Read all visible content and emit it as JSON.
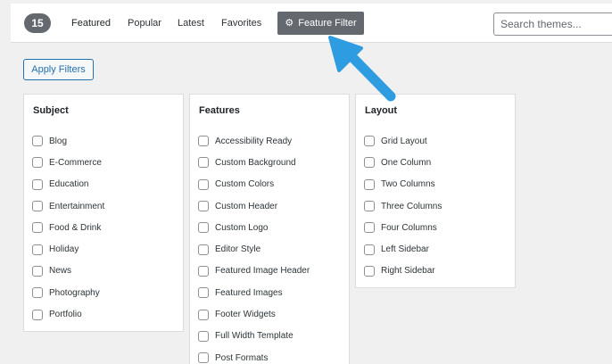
{
  "toolbar": {
    "count": "15",
    "tabs": [
      {
        "label": "Featured"
      },
      {
        "label": "Popular"
      },
      {
        "label": "Latest"
      },
      {
        "label": "Favorites"
      }
    ],
    "feature_filter_label": "Feature Filter",
    "search_placeholder": "Search themes..."
  },
  "apply_filters_label": "Apply Filters",
  "columns": [
    {
      "heading": "Subject",
      "options": [
        "Blog",
        "E-Commerce",
        "Education",
        "Entertainment",
        "Food & Drink",
        "Holiday",
        "News",
        "Photography",
        "Portfolio"
      ]
    },
    {
      "heading": "Features",
      "options": [
        "Accessibility Ready",
        "Custom Background",
        "Custom Colors",
        "Custom Header",
        "Custom Logo",
        "Editor Style",
        "Featured Image Header",
        "Featured Images",
        "Footer Widgets",
        "Full Width Template",
        "Post Formats"
      ]
    },
    {
      "heading": "Layout",
      "options": [
        "Grid Layout",
        "One Column",
        "Two Columns",
        "Three Columns",
        "Four Columns",
        "Left Sidebar",
        "Right Sidebar"
      ]
    }
  ],
  "colors": {
    "badge": "#646970",
    "button_accent": "#2271b1",
    "arrow": "#2e9ce0"
  },
  "icons": {
    "filter": "gear-icon",
    "annotation": "arrow-icon"
  }
}
